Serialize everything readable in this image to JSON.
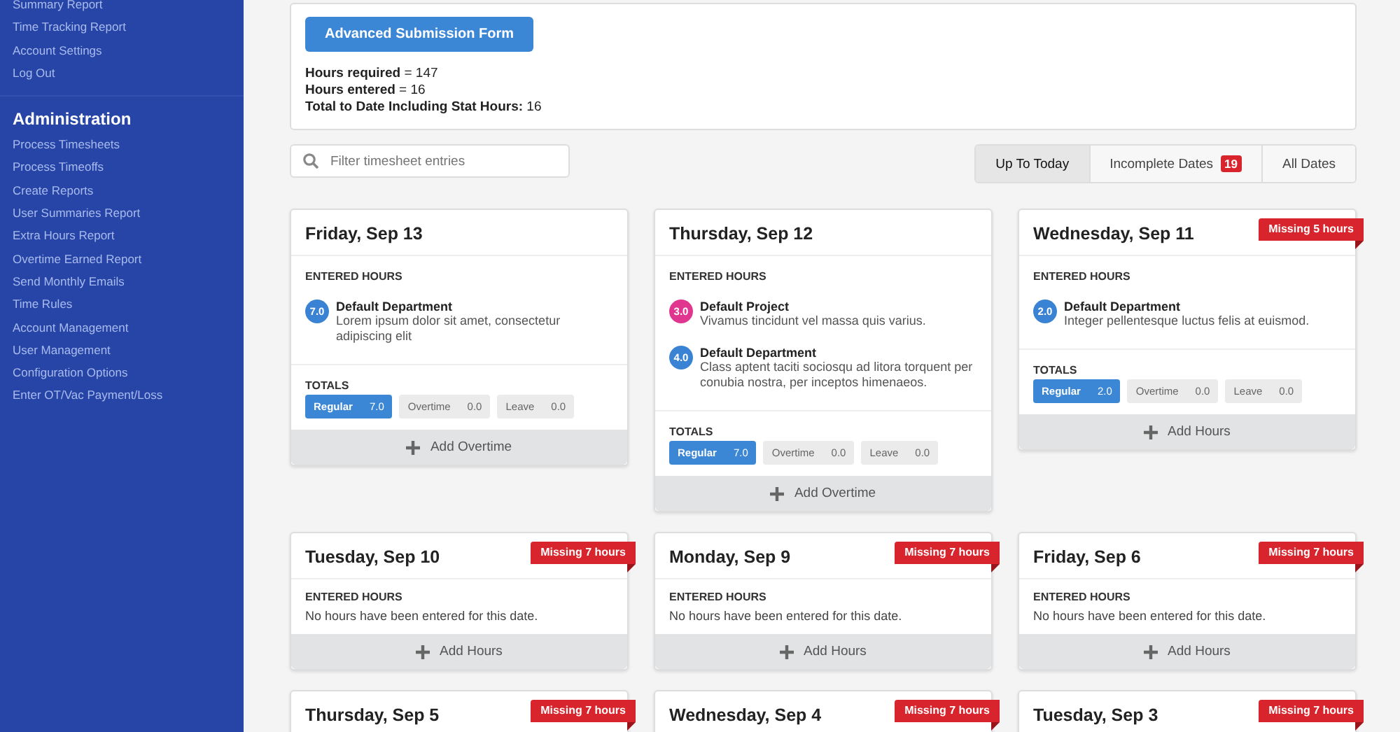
{
  "sidebar": {
    "sections": [
      {
        "items": [
          "Summary Report",
          "Time Tracking Report",
          "Account Settings",
          "Log Out"
        ]
      },
      {
        "title": "Administration",
        "items": [
          "Process Timesheets",
          "Process Timeoffs",
          "Create Reports",
          "User Summaries Report",
          "Extra Hours Report",
          "Overtime Earned Report",
          "Send Monthly Emails",
          "Time Rules",
          "Account Management",
          "User Management",
          "Configuration Options",
          "Enter OT/Vac Payment/Loss"
        ]
      }
    ]
  },
  "summary": {
    "button": "Advanced Submission Form",
    "lines": [
      "**Hours required** = 147",
      "**Hours entered** = 16",
      "**Total to Date Including Stat Hours:** 16"
    ]
  },
  "search": {
    "placeholder": "Filter timesheet entries"
  },
  "filters": [
    {
      "label": "Up To Today",
      "selected": true
    },
    {
      "label": "Incomplete Dates",
      "count": "19",
      "selected": false
    },
    {
      "label": "All Dates",
      "selected": false
    }
  ],
  "days": [
    {
      "title": "Friday, Sep 13",
      "section": "ENTERED HOURS",
      "entries": [
        {
          "hours": "7.0",
          "color": "#3a82d4",
          "name": "Default Department",
          "note": "Lorem ipsum dolor sit amet, consectetur adipiscing elit"
        }
      ],
      "totals_label": "TOTALS",
      "totals": [
        {
          "label": "Regular",
          "value": "7.0",
          "active": true
        },
        {
          "label": "Overtime",
          "value": "0.0",
          "active": false
        },
        {
          "label": "Leave",
          "value": "0.0",
          "active": false
        }
      ],
      "action": "Add Overtime"
    },
    {
      "title": "Thursday, Sep 12",
      "section": "ENTERED HOURS",
      "entries": [
        {
          "hours": "3.0",
          "color": "#e0368f",
          "name": "Default Project",
          "note": "Vivamus tincidunt vel massa quis varius."
        },
        {
          "hours": "4.0",
          "color": "#3a82d4",
          "name": "Default Department",
          "note": "Class aptent taciti sociosqu ad litora torquent per conubia nostra, per inceptos himenaeos."
        }
      ],
      "totals_label": "TOTALS",
      "totals": [
        {
          "label": "Regular",
          "value": "7.0",
          "active": true
        },
        {
          "label": "Overtime",
          "value": "0.0",
          "active": false
        },
        {
          "label": "Leave",
          "value": "0.0",
          "active": false
        }
      ],
      "action": "Add Overtime"
    },
    {
      "title": "Wednesday, Sep 11",
      "missing": "Missing 5 hours",
      "section": "ENTERED HOURS",
      "entries": [
        {
          "hours": "2.0",
          "color": "#3a82d4",
          "name": "Default Department",
          "note": "Integer pellentesque luctus felis at euismod."
        }
      ],
      "totals_label": "TOTALS",
      "totals": [
        {
          "label": "Regular",
          "value": "2.0",
          "active": true
        },
        {
          "label": "Overtime",
          "value": "0.0",
          "active": false
        },
        {
          "label": "Leave",
          "value": "0.0",
          "active": false
        }
      ],
      "action": "Add Hours"
    },
    {
      "title": "Tuesday, Sep 10",
      "missing": "Missing 7 hours",
      "section": "ENTERED HOURS",
      "empty": "No hours have been entered for this date.",
      "action": "Add Hours"
    },
    {
      "title": "Monday, Sep 9",
      "missing": "Missing 7 hours",
      "section": "ENTERED HOURS",
      "empty": "No hours have been entered for this date.",
      "action": "Add Hours"
    },
    {
      "title": "Friday, Sep 6",
      "missing": "Missing 7 hours",
      "section": "ENTERED HOURS",
      "empty": "No hours have been entered for this date.",
      "action": "Add Hours"
    },
    {
      "title": "Thursday, Sep 5",
      "missing": "Missing 7 hours"
    },
    {
      "title": "Wednesday, Sep 4",
      "missing": "Missing 7 hours"
    },
    {
      "title": "Tuesday, Sep 3",
      "missing": "Missing 7 hours"
    }
  ]
}
